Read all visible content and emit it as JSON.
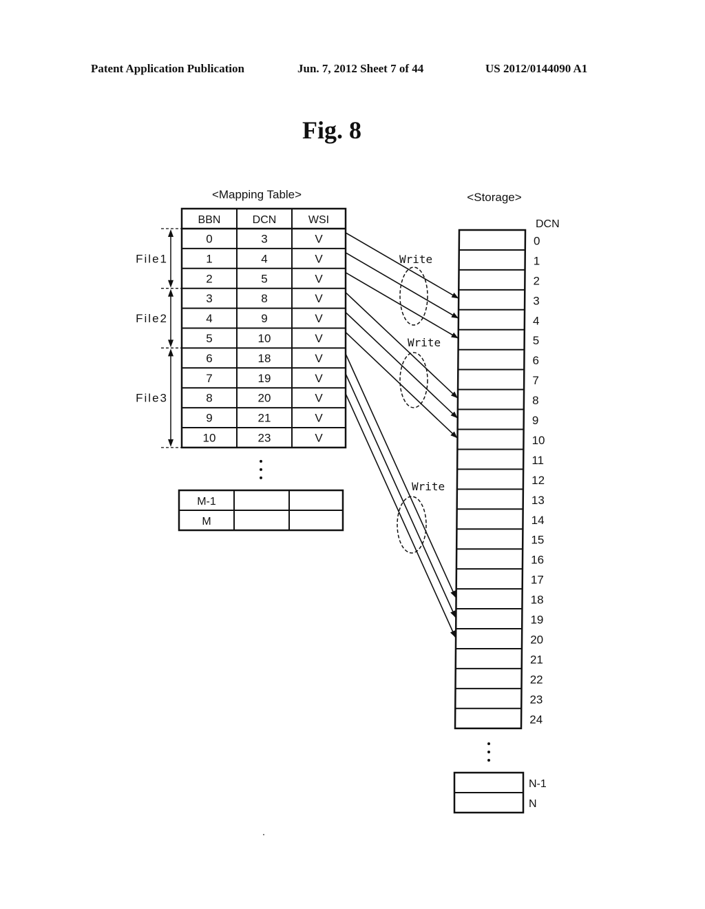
{
  "header": {
    "left": "Patent Application Publication",
    "middle": "Jun. 7, 2012   Sheet 7 of 44",
    "right": "US 2012/0144090 A1"
  },
  "figure_title": "Fig. 8",
  "mapping_table": {
    "caption": "<Mapping Table>",
    "columns": [
      "BBN",
      "DCN",
      "WSI"
    ],
    "rows": [
      [
        "0",
        "3",
        "V"
      ],
      [
        "1",
        "4",
        "V"
      ],
      [
        "2",
        "5",
        "V"
      ],
      [
        "3",
        "8",
        "V"
      ],
      [
        "4",
        "9",
        "V"
      ],
      [
        "5",
        "10",
        "V"
      ],
      [
        "6",
        "18",
        "V"
      ],
      [
        "7",
        "19",
        "V"
      ],
      [
        "8",
        "20",
        "V"
      ],
      [
        "9",
        "21",
        "V"
      ],
      [
        "10",
        "23",
        "V"
      ]
    ],
    "ellipsis": "⋮",
    "tail_rows": [
      [
        "M-1",
        "",
        ""
      ],
      [
        "M",
        "",
        ""
      ]
    ]
  },
  "files": [
    {
      "label": "File1",
      "first_row": 0,
      "last_row": 2
    },
    {
      "label": "File2",
      "first_row": 3,
      "last_row": 5
    },
    {
      "label": "File3",
      "first_row": 6,
      "last_row": 10
    }
  ],
  "storage": {
    "caption": "<Storage>",
    "column_label": "DCN",
    "cells": [
      "0",
      "1",
      "2",
      "3",
      "4",
      "5",
      "6",
      "7",
      "8",
      "9",
      "10",
      "11",
      "12",
      "13",
      "14",
      "15",
      "16",
      "17",
      "18",
      "19",
      "20",
      "21",
      "22",
      "23",
      "24"
    ],
    "ellipsis": "⋮",
    "tail_cells": [
      "N-1",
      "N"
    ]
  },
  "write_groups": [
    {
      "label": "Write",
      "arrows": [
        {
          "from_row": 0,
          "to_cell": 3
        },
        {
          "from_row": 1,
          "to_cell": 4
        },
        {
          "from_row": 2,
          "to_cell": 5
        }
      ]
    },
    {
      "label": "Write",
      "arrows": [
        {
          "from_row": 3,
          "to_cell": 8
        },
        {
          "from_row": 4,
          "to_cell": 9
        },
        {
          "from_row": 5,
          "to_cell": 10
        }
      ]
    },
    {
      "label": "Write",
      "arrows": [
        {
          "from_row": 6,
          "to_cell": 18
        },
        {
          "from_row": 7,
          "to_cell": 19
        },
        {
          "from_row": 8,
          "to_cell": 20
        }
      ]
    }
  ]
}
